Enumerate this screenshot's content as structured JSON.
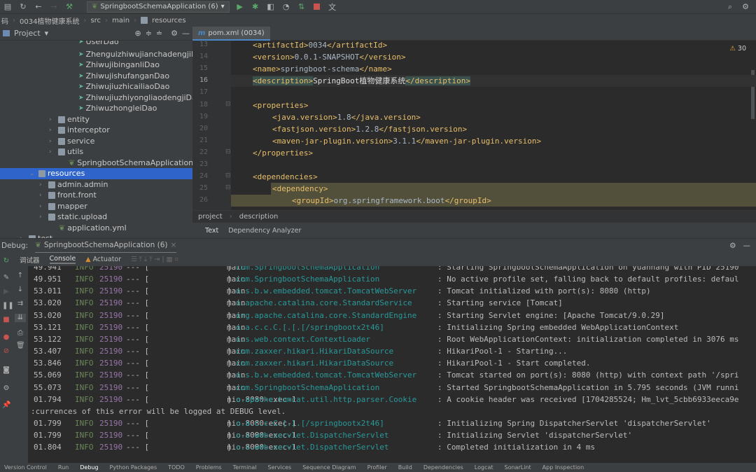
{
  "toolbar": {
    "run_config": "SpringbootSchemaApplication (6)"
  },
  "breadcrumb": [
    "码",
    "0034植物健康系统",
    "src",
    "main",
    "resources"
  ],
  "project_panel": {
    "title": "Project"
  },
  "tree": [
    {
      "label": "UserDao",
      "indent": 112,
      "icon": "interface",
      "y": -6
    },
    {
      "label": "ZhenguizhiwujianchadengjiDao",
      "indent": 112,
      "icon": "interface"
    },
    {
      "label": "ZhiwujibinganliDao",
      "indent": 112,
      "icon": "interface"
    },
    {
      "label": "ZhiwujishufanganDao",
      "indent": 112,
      "icon": "interface"
    },
    {
      "label": "ZhiwujiuzhicailiaoDao",
      "indent": 112,
      "icon": "interface"
    },
    {
      "label": "ZhiwujiuzhiyongliaodengjiDao",
      "indent": 112,
      "icon": "interface"
    },
    {
      "label": "ZhiwuzhongleiDao",
      "indent": 112,
      "icon": "interface"
    },
    {
      "label": "entity",
      "indent": 84,
      "icon": "folder",
      "arrow": true
    },
    {
      "label": "interceptor",
      "indent": 84,
      "icon": "folder",
      "arrow": true
    },
    {
      "label": "service",
      "indent": 84,
      "icon": "folder",
      "arrow": true
    },
    {
      "label": "utils",
      "indent": 84,
      "icon": "folder",
      "arrow": true
    },
    {
      "label": "SpringbootSchemaApplication",
      "indent": 98,
      "icon": "spring-class"
    },
    {
      "label": "resources",
      "indent": 56,
      "icon": "resources-folder",
      "arrow": true,
      "open": true,
      "selected": true
    },
    {
      "label": "admin.admin",
      "indent": 70,
      "icon": "folder",
      "arrow": true
    },
    {
      "label": "front.front",
      "indent": 70,
      "icon": "folder",
      "arrow": true
    },
    {
      "label": "mapper",
      "indent": 70,
      "icon": "folder",
      "arrow": true
    },
    {
      "label": "static.upload",
      "indent": 70,
      "icon": "folder",
      "arrow": true
    },
    {
      "label": "application.yml",
      "indent": 84,
      "icon": "yml"
    },
    {
      "label": "test",
      "indent": 42,
      "icon": "folder",
      "arrow": true
    }
  ],
  "editor": {
    "tab": "pom.xml (0034)",
    "warnings": "30",
    "lines": [
      {
        "n": "13",
        "indent": 0,
        "open": "artifactId",
        "text": "0034"
      },
      {
        "n": "14",
        "indent": 0,
        "open": "version",
        "text": "0.0.1-SNAPSHOT"
      },
      {
        "n": "15",
        "indent": 0,
        "open": "name",
        "text": "springboot-schema"
      },
      {
        "n": "16",
        "indent": 0,
        "open": "description",
        "text": "SpringBoot植物健康系统",
        "current": true
      },
      {
        "n": "17",
        "indent": 0
      },
      {
        "n": "18",
        "indent": 0,
        "open": "properties",
        "only": true
      },
      {
        "n": "19",
        "indent": 1,
        "open": "java.version",
        "text": "1.8"
      },
      {
        "n": "20",
        "indent": 1,
        "open": "fastjson.version",
        "text": "1.2.8"
      },
      {
        "n": "21",
        "indent": 1,
        "open": "maven-jar-plugin.version",
        "text": "3.1.1"
      },
      {
        "n": "22",
        "indent": 0,
        "close": "properties"
      },
      {
        "n": "23",
        "indent": 0
      },
      {
        "n": "24",
        "indent": 0,
        "open": "dependencies",
        "only": true
      },
      {
        "n": "25",
        "indent": 1,
        "open": "dependency",
        "only": true,
        "dep": true
      },
      {
        "n": "26",
        "indent": 2,
        "open": "groupId",
        "text": "org.springframework.boot",
        "dep": true
      }
    ],
    "breadcrumb": [
      "project",
      "description"
    ],
    "subtabs": [
      "Text",
      "Dependency Analyzer"
    ]
  },
  "debug": {
    "label": "Debug:",
    "session": "SpringbootSchemaApplication (6)",
    "subtabs": [
      "调试器",
      "Console",
      "Actuator"
    ]
  },
  "console": [
    {
      "t": "49.941",
      "lvl": "INFO",
      "pid": "25190",
      "thread": "main",
      "logger": "com.SpringbootSchemaApplication",
      "msg": ": Starting SpringbootSchemaApplication on yuanhang with PID 25190"
    },
    {
      "t": "49.951",
      "lvl": "INFO",
      "pid": "25190",
      "thread": "main",
      "logger": "com.SpringbootSchemaApplication",
      "msg": ": No active profile set, falling back to default profiles: defaul"
    },
    {
      "t": "53.011",
      "lvl": "INFO",
      "pid": "25190",
      "thread": "main",
      "logger": "o.s.b.w.embedded.tomcat.TomcatWebServer",
      "msg": ": Tomcat initialized with port(s): 8080 (http)"
    },
    {
      "t": "53.020",
      "lvl": "INFO",
      "pid": "25190",
      "thread": "main",
      "logger": "o.apache.catalina.core.StandardService",
      "msg": ": Starting service [Tomcat]"
    },
    {
      "t": "53.020",
      "lvl": "INFO",
      "pid": "25190",
      "thread": "main",
      "logger": "org.apache.catalina.core.StandardEngine",
      "msg": ": Starting Servlet engine: [Apache Tomcat/9.0.29]"
    },
    {
      "t": "53.121",
      "lvl": "INFO",
      "pid": "25190",
      "thread": "main",
      "logger": "o.a.c.c.C.[.[.[/springbootx2t46]",
      "msg": ": Initializing Spring embedded WebApplicationContext"
    },
    {
      "t": "53.122",
      "lvl": "INFO",
      "pid": "25190",
      "thread": "main",
      "logger": "o.s.web.context.ContextLoader",
      "msg": ": Root WebApplicationContext: initialization completed in 3076 ms"
    },
    {
      "t": "53.407",
      "lvl": "INFO",
      "pid": "25190",
      "thread": "main",
      "logger": "com.zaxxer.hikari.HikariDataSource",
      "msg": ": HikariPool-1 - Starting..."
    },
    {
      "t": "53.846",
      "lvl": "INFO",
      "pid": "25190",
      "thread": "main",
      "logger": "com.zaxxer.hikari.HikariDataSource",
      "msg": ": HikariPool-1 - Start completed."
    },
    {
      "t": "55.069",
      "lvl": "INFO",
      "pid": "25190",
      "thread": "main",
      "logger": "o.s.b.w.embedded.tomcat.TomcatWebServer",
      "msg": ": Tomcat started on port(s): 8080 (http) with context path '/spri"
    },
    {
      "t": "55.073",
      "lvl": "INFO",
      "pid": "25190",
      "thread": "main",
      "logger": "com.SpringbootSchemaApplication",
      "msg": ": Started SpringbootSchemaApplication in 5.795 seconds (JVM runni"
    },
    {
      "t": "01.794",
      "lvl": "INFO",
      "pid": "25190",
      "thread": "nio-8080-exec-1",
      "logger": "o.apache.tomcat.util.http.parser.Cookie",
      "msg": ": A cookie header was received [1704285524; Hm_lvt_5cbb6933eeca9e"
    },
    {
      "plain": ":currences of this error will be logged at DEBUG level."
    },
    {
      "t": "01.799",
      "lvl": "INFO",
      "pid": "25190",
      "thread": "nio-8080-exec-1",
      "logger": "o.a.c.c.C.[.[.[/springbootx2t46]",
      "msg": ": Initializing Spring DispatcherServlet 'dispatcherServlet'"
    },
    {
      "t": "01.799",
      "lvl": "INFO",
      "pid": "25190",
      "thread": "nio-8080-exec-1",
      "logger": "o.s.web.servlet.DispatcherServlet",
      "msg": ": Initializing Servlet 'dispatcherServlet'"
    },
    {
      "t": "01.804",
      "lvl": "INFO",
      "pid": "25190",
      "thread": "nio-8080-exec-1",
      "logger": "o.s.web.servlet.DispatcherServlet",
      "msg": ": Completed initialization in 4 ms"
    }
  ],
  "bottom_tabs": [
    "Version Control",
    "Run",
    "Debug",
    "Python Packages",
    "TODO",
    "Problems",
    "Terminal",
    "Services",
    "Sequence Diagram",
    "Profiler",
    "Build",
    "Dependencies",
    "Logcat",
    "SonarLint",
    "App Inspection"
  ],
  "bottom_active": "Debug",
  "colors": {
    "selection": "#2f65ca",
    "info": "#6a8759",
    "pid": "#9876aa",
    "logger": "#299999",
    "tag": "#e8bf6a"
  }
}
